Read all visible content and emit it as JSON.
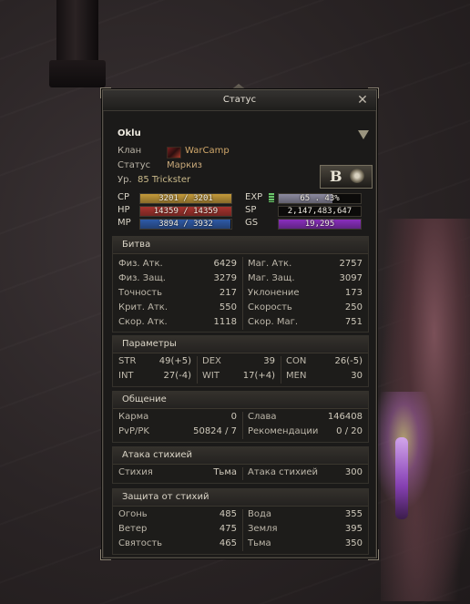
{
  "window": {
    "title": "Статус"
  },
  "character": {
    "name": "Oklu",
    "clan_label": "Клан",
    "clan_name": "WarCamp",
    "status_label": "Статус",
    "status_value": "Маркиз",
    "level_label": "Ур.",
    "level_value": "85 Trickster",
    "grade": "B"
  },
  "bars": {
    "cp": {
      "label": "CP",
      "text": "3201 / 3201",
      "fill": 1.0,
      "color": "#c49a3a"
    },
    "hp": {
      "label": "HP",
      "text": "14359 / 14359",
      "fill": 1.0,
      "color": "#a8332e"
    },
    "mp": {
      "label": "MP",
      "text": "3894 / 3932",
      "fill": 0.99,
      "color": "#2e5aa8"
    },
    "exp": {
      "label": "EXP",
      "text": "65 . 43%",
      "fill": 0.6543,
      "color": "#8c8aa0"
    },
    "sp": {
      "label": "SP",
      "text": "2,147,483,647",
      "fill": 0.0,
      "color": "#555555"
    },
    "gs": {
      "label": "GS",
      "text": "19,295",
      "fill": 1.0,
      "color": "#8a2fbf"
    }
  },
  "battle": {
    "title": "Битва",
    "left": [
      {
        "label": "Физ. Атк.",
        "value": "6429"
      },
      {
        "label": "Физ. Защ.",
        "value": "3279"
      },
      {
        "label": "Точность",
        "value": "217"
      },
      {
        "label": "Крит. Атк.",
        "value": "550"
      },
      {
        "label": "Скор. Атк.",
        "value": "1118"
      }
    ],
    "right": [
      {
        "label": "Маг. Атк.",
        "value": "2757"
      },
      {
        "label": "Маг. Защ.",
        "value": "3097"
      },
      {
        "label": "Уклонение",
        "value": "173"
      },
      {
        "label": "Скорость",
        "value": "250"
      },
      {
        "label": "Скор. Маг.",
        "value": "751"
      }
    ]
  },
  "params": {
    "title": "Параметры",
    "row1": [
      {
        "label": "STR",
        "value": "49(+5)"
      },
      {
        "label": "DEX",
        "value": "39"
      },
      {
        "label": "CON",
        "value": "26(-5)"
      }
    ],
    "row2": [
      {
        "label": "INT",
        "value": "27(-4)"
      },
      {
        "label": "WIT",
        "value": "17(+4)"
      },
      {
        "label": "MEN",
        "value": "30"
      }
    ]
  },
  "social": {
    "title": "Общение",
    "left": [
      {
        "label": "Карма",
        "value": "0"
      },
      {
        "label": "PvP/PK",
        "value": "50824 / 7"
      }
    ],
    "right": [
      {
        "label": "Слава",
        "value": "146408"
      },
      {
        "label": "Рекомендации",
        "value": "0 / 20"
      }
    ]
  },
  "attack_element": {
    "title": "Атака стихией",
    "left": {
      "label": "Стихия",
      "value": "Тьма"
    },
    "right": {
      "label": "Атака стихией",
      "value": "300"
    }
  },
  "defense_element": {
    "title": "Защита от стихий",
    "left": [
      {
        "label": "Огонь",
        "value": "485"
      },
      {
        "label": "Ветер",
        "value": "475"
      },
      {
        "label": "Святость",
        "value": "465"
      }
    ],
    "right": [
      {
        "label": "Вода",
        "value": "355"
      },
      {
        "label": "Земля",
        "value": "395"
      },
      {
        "label": "Тьма",
        "value": "350"
      }
    ]
  }
}
